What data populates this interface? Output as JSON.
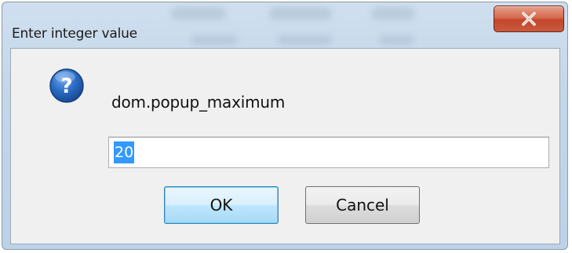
{
  "window": {
    "title": "Enter integer value",
    "close_icon": "close-x-icon"
  },
  "dialog": {
    "icon": "question-icon",
    "pref_name": "dom.popup_maximum",
    "input_value": "20",
    "ok_label": "OK",
    "cancel_label": "Cancel"
  },
  "colors": {
    "selection": "#3399ff",
    "close_button": "#c4452a",
    "question_icon": "#1f5fb5",
    "client_bg": "#f0f0f0"
  }
}
